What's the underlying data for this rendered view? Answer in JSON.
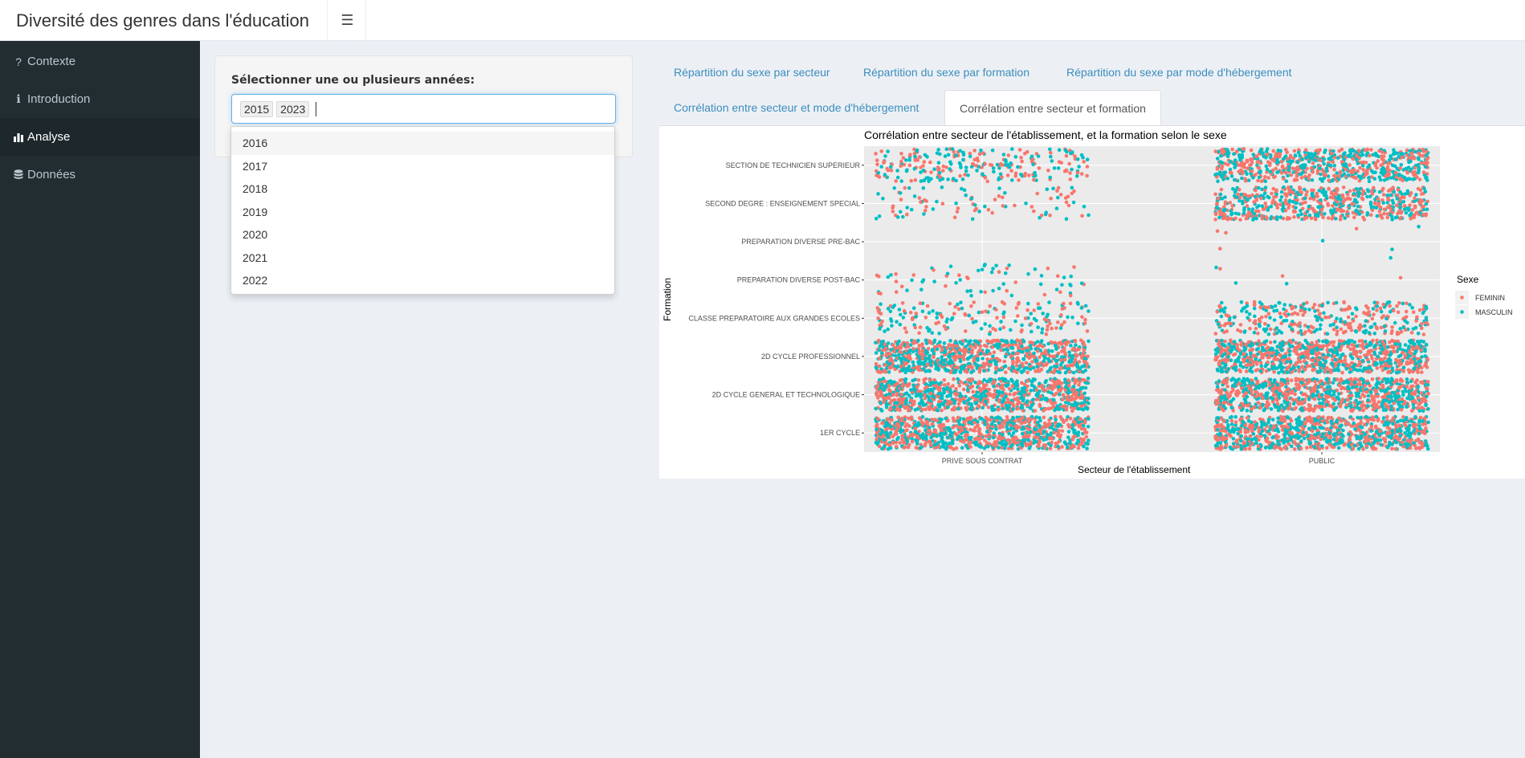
{
  "app": {
    "title": "Diversité des genres dans l'éducation",
    "toggle_icon": "☰"
  },
  "sidebar": {
    "items": [
      {
        "label": "Contexte",
        "icon": "question-icon",
        "glyph": "?"
      },
      {
        "label": "Introduction",
        "icon": "info-icon",
        "glyph": "ℹ"
      },
      {
        "label": "Analyse",
        "icon": "bar-chart-icon",
        "glyph": "▮",
        "active": true
      },
      {
        "label": "Données",
        "icon": "database-icon",
        "glyph": "≣"
      }
    ]
  },
  "filter": {
    "label": "Sélectionner une ou plusieurs années:",
    "selected": [
      "2015",
      "2023"
    ],
    "options": [
      "2016",
      "2017",
      "2018",
      "2019",
      "2020",
      "2021",
      "2022"
    ]
  },
  "tabs": [
    "Répartition du sexe par secteur",
    "Répartition du sexe par formation",
    "Répartition du sexe par mode d'hébergement",
    "Corrélation entre secteur et mode d'hébergement",
    "Corrélation entre secteur et formation"
  ],
  "active_tab": 4,
  "chart_data": {
    "type": "scatter",
    "title": "Corrélation entre secteur de l'établissement, et la formation selon le sexe",
    "xlabel": "Secteur de l'établissement",
    "ylabel": "Formation",
    "x_categories": [
      "PRIVE SOUS CONTRAT",
      "PUBLIC"
    ],
    "y_categories": [
      "1ER CYCLE",
      "2D CYCLE GENERAL ET TECHNOLOGIQUE",
      "2D CYCLE PROFESSIONNEL",
      "CLASSE PREPARATOIRE AUX GRANDES ECOLES",
      "PREPARATION DIVERSE POST-BAC",
      "PREPARATION DIVERSE PRE-BAC",
      "SECOND DEGRE : ENSEIGNEMENT SPECIAL",
      "SECTION DE TECHNICIEN SUPERIEUR"
    ],
    "jitter": "points jittered around each category pair",
    "legend": {
      "title": "Sexe",
      "position": "right",
      "entries": [
        {
          "name": "FEMININ",
          "color": "#f8766d"
        },
        {
          "name": "MASCULIN",
          "color": "#00bfc4"
        }
      ]
    },
    "density": {
      "PRIVE SOUS CONTRAT": [
        900,
        900,
        900,
        180,
        70,
        0,
        90,
        260
      ],
      "PUBLIC": [
        900,
        900,
        900,
        340,
        6,
        8,
        600,
        700
      ]
    },
    "grid": true,
    "panel_background": "#ebebeb"
  }
}
